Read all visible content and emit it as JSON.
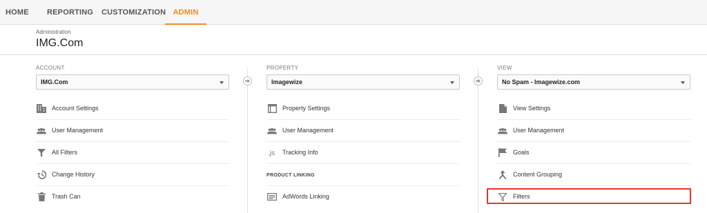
{
  "nav": {
    "tabs": [
      {
        "label": "HOME"
      },
      {
        "label": "REPORTING"
      },
      {
        "label": "CUSTOMIZATION"
      },
      {
        "label": "ADMIN"
      }
    ],
    "active_color": "#f08a24"
  },
  "header": {
    "breadcrumb": "Administration",
    "title": "IMG.Com"
  },
  "account": {
    "label": "ACCOUNT",
    "selected": "IMG.Com",
    "items": [
      {
        "label": "Account Settings",
        "icon": "building-icon"
      },
      {
        "label": "User Management",
        "icon": "users-icon"
      },
      {
        "label": "All Filters",
        "icon": "filter-icon"
      },
      {
        "label": "Change History",
        "icon": "history-icon"
      },
      {
        "label": "Trash Can",
        "icon": "trash-icon"
      }
    ]
  },
  "property": {
    "label": "PROPERTY",
    "selected": "Imagewize",
    "items": [
      {
        "label": "Property Settings",
        "icon": "window-icon"
      },
      {
        "label": "User Management",
        "icon": "users-icon"
      },
      {
        "label": "Tracking Info",
        "icon": "js-icon"
      }
    ],
    "linking_label": "PRODUCT LINKING",
    "linking_items": [
      {
        "label": "AdWords Linking",
        "icon": "adwords-icon"
      }
    ]
  },
  "view": {
    "label": "VIEW",
    "selected": "No Spam - Imagewize.com",
    "items": [
      {
        "label": "View Settings",
        "icon": "document-icon"
      },
      {
        "label": "User Management",
        "icon": "users-icon"
      },
      {
        "label": "Goals",
        "icon": "flag-icon"
      },
      {
        "label": "Content Grouping",
        "icon": "grouping-icon"
      },
      {
        "label": "Filters",
        "icon": "filter-icon"
      }
    ],
    "highlight_color": "#e8342a"
  }
}
